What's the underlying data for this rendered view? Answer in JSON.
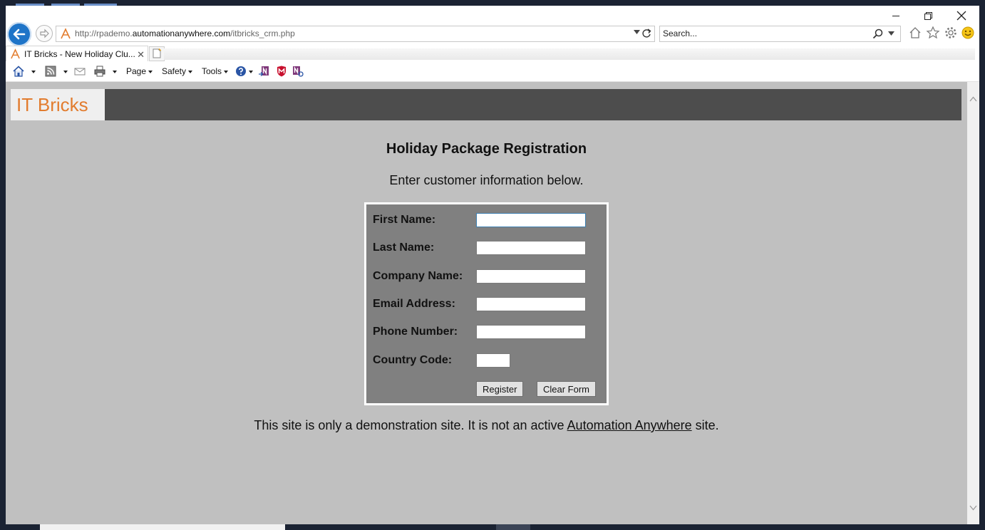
{
  "browser": {
    "address": {
      "url_prefix": "http://rpademo.",
      "url_host": "automationanywhere.com",
      "url_path": "/itbricks_crm.php"
    },
    "search": {
      "placeholder": "Search..."
    },
    "tab": {
      "title": "IT Bricks - New Holiday Clu...",
      "close": "✕"
    },
    "command_bar": {
      "page_label": "Page",
      "safety_label": "Safety",
      "tools_label": "Tools"
    }
  },
  "site": {
    "logo_text": "IT Bricks",
    "title": "Holiday Package Registration",
    "subtitle": "Enter customer information below.",
    "form": {
      "first_name_label": "First Name:",
      "last_name_label": "Last Name:",
      "company_name_label": "Company Name:",
      "email_label": "Email Address:",
      "phone_label": "Phone Number:",
      "country_code_label": "Country Code:",
      "register_label": "Register",
      "clear_label": "Clear Form"
    },
    "footer": {
      "prefix": "This site is only a demonstration site. It is not an active ",
      "link": "Automation Anywhere",
      "suffix": " site."
    }
  },
  "colors": {
    "header_bar": "#4d4d4d",
    "logo_orange": "#e27c2e",
    "page_background": "#c0c0c0",
    "form_background": "#808080",
    "back_button": "#1e74c8"
  }
}
